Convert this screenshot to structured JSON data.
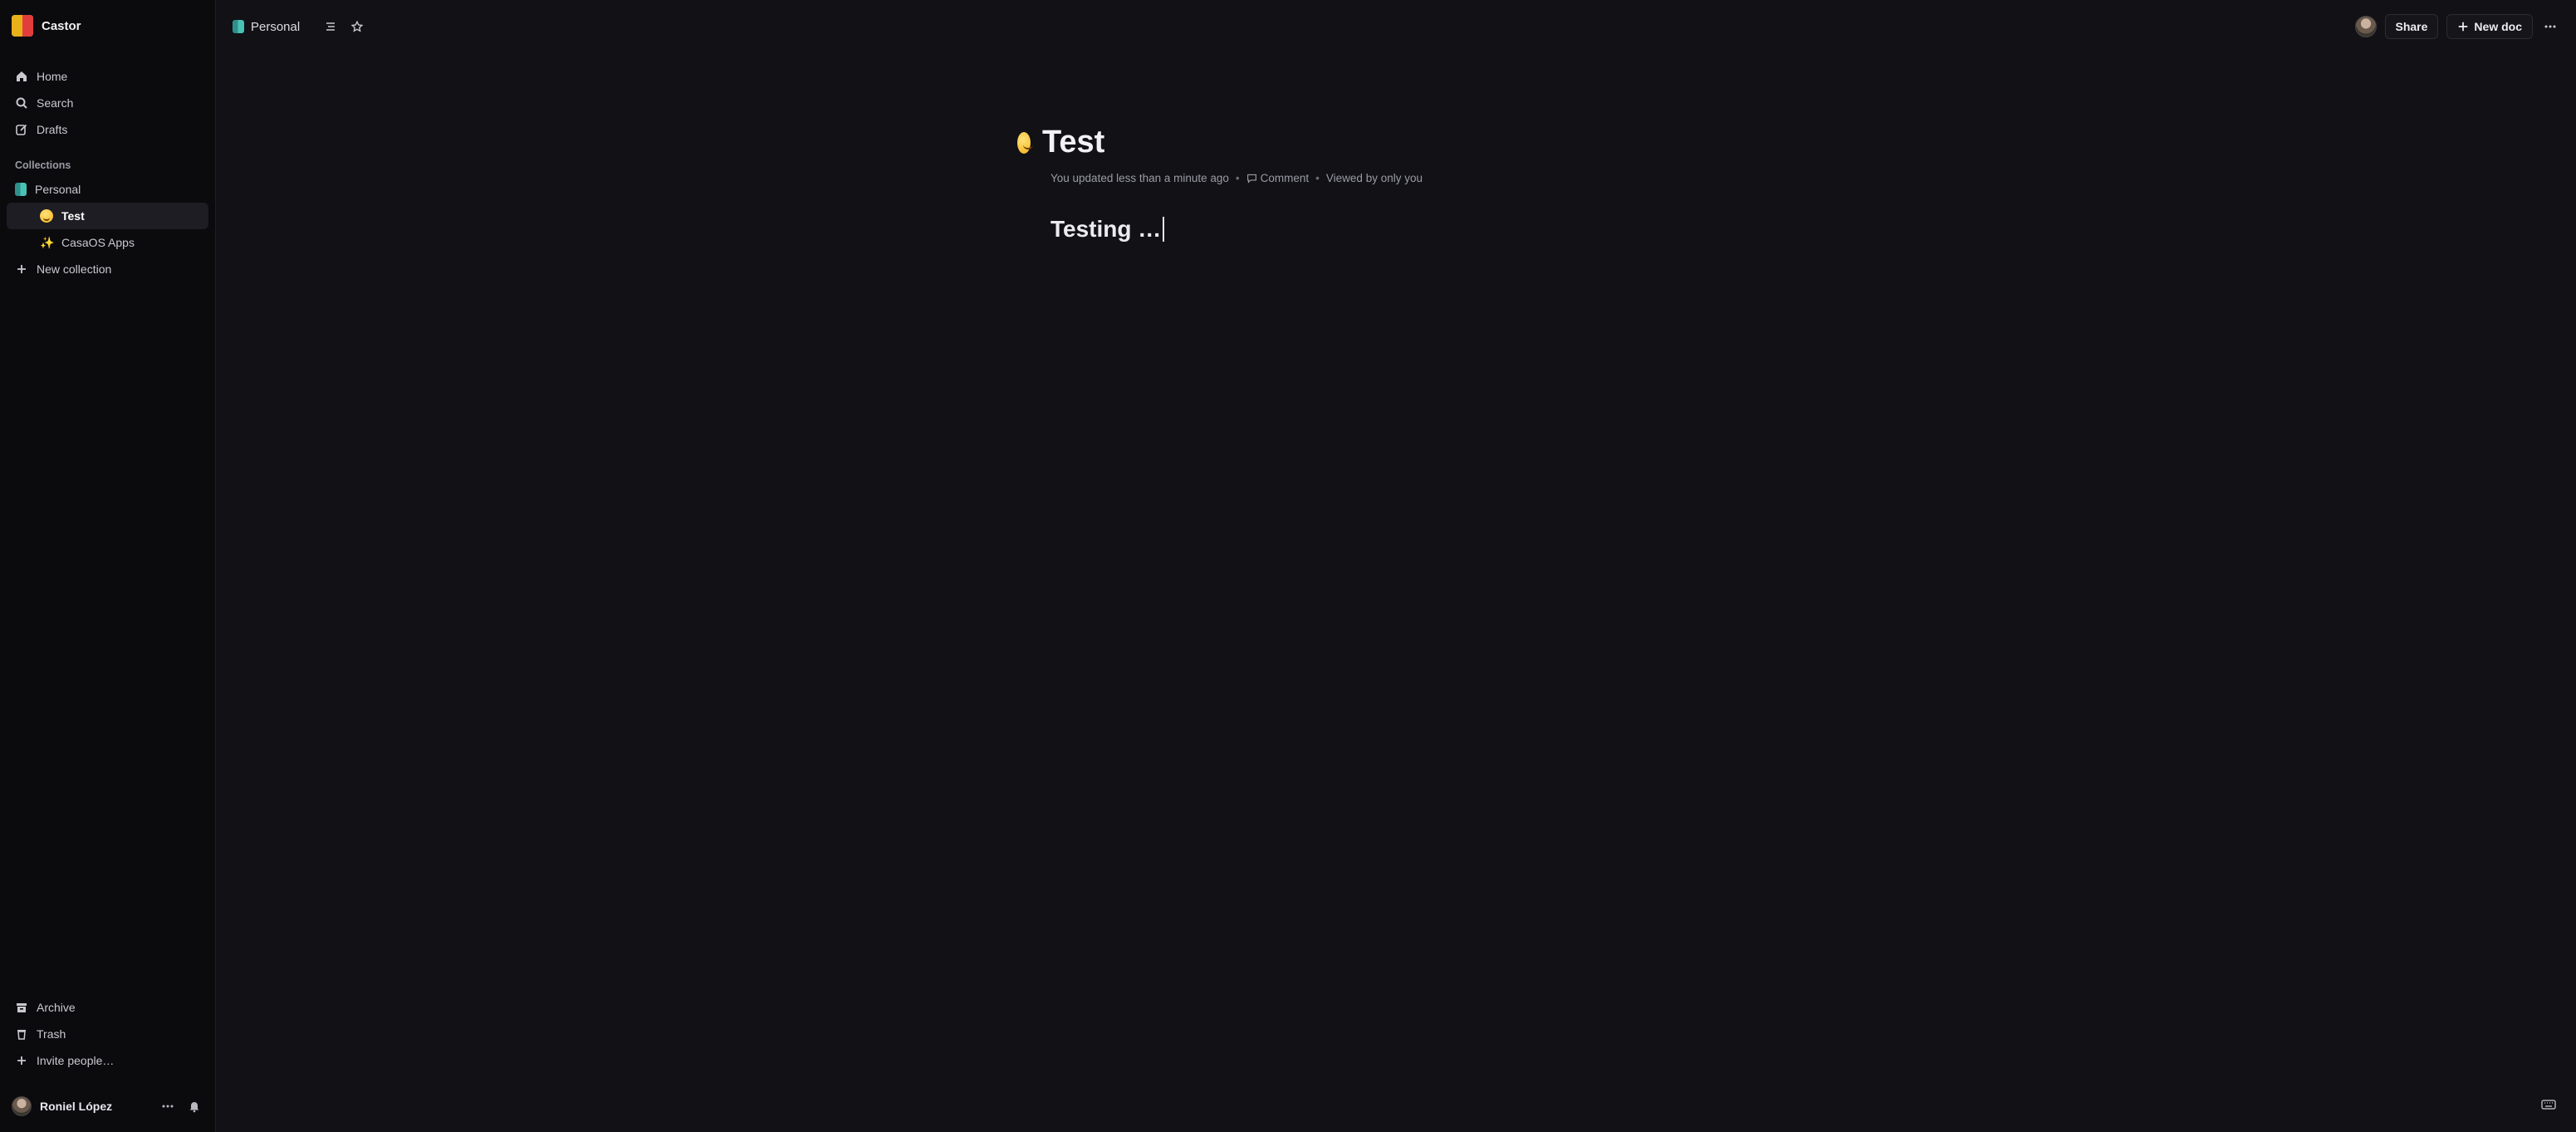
{
  "team": {
    "name": "Castor"
  },
  "nav": {
    "home": "Home",
    "search": "Search",
    "drafts": "Drafts"
  },
  "collections": {
    "label": "Collections",
    "personal": "Personal",
    "children": [
      "Test",
      "CasaOS Apps"
    ],
    "new_collection": "New collection"
  },
  "bottom_nav": {
    "archive": "Archive",
    "trash": "Trash",
    "invite": "Invite people…"
  },
  "user": {
    "name": "Roniel López"
  },
  "header": {
    "breadcrumb": "Personal",
    "share": "Share",
    "new_doc": "New doc"
  },
  "document": {
    "title": "Test",
    "meta_updated": "You updated less than a minute ago",
    "meta_comment": "Comment",
    "meta_viewed": "Viewed by only you",
    "body": "Testing …"
  },
  "colors": {
    "background": "#111116",
    "sidebar": "#0b0b0e",
    "collection_icon": "#48c2b5"
  },
  "icons": {
    "home": "home-icon",
    "search": "search-icon",
    "drafts": "edit-icon",
    "archive": "archive-icon",
    "trash": "trash-icon",
    "invite": "plus-icon",
    "more": "more-icon",
    "bell": "bell-icon",
    "toc": "table-of-contents-icon",
    "star": "star-icon",
    "keyboard": "keyboard-icon"
  }
}
